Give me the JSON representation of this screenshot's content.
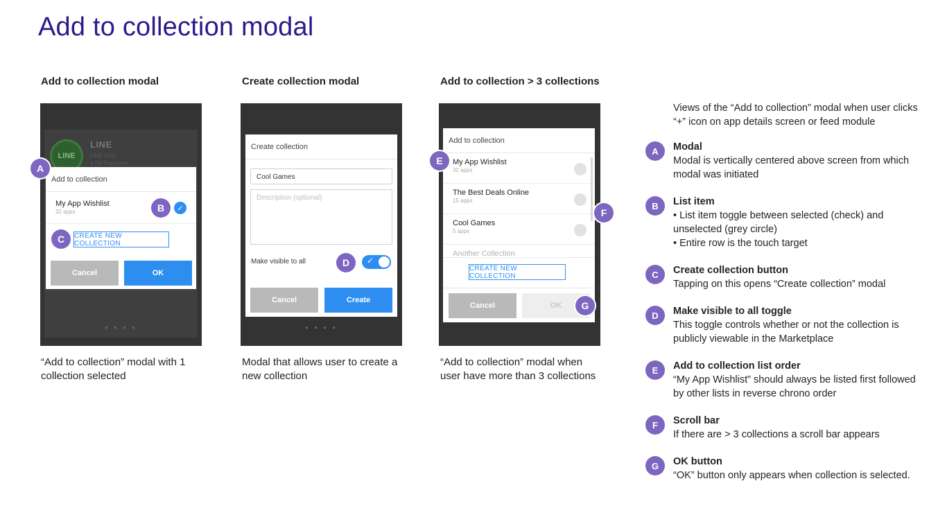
{
  "page_title": "Add to collection modal",
  "columns": [
    {
      "heading": "Add to collection modal",
      "caption_lines": [
        "“Add to collection” modal with 1",
        "collection selected"
      ]
    },
    {
      "heading": "Create collection modal",
      "caption_lines": [
        "Modal that allows user to create a",
        "new collection"
      ]
    },
    {
      "heading": "Add to collection > 3 collections",
      "caption_lines": [
        "“Add to collection” modal when",
        "user have more than 3 collections"
      ]
    }
  ],
  "screen1": {
    "bg_logo": "LINE",
    "bg_app_name": "LINE",
    "bg_app_sub": [
      "LINE Corp.",
      "4.5M Everyone"
    ],
    "modal_title": "Add to collection",
    "item": {
      "name": "My App Wishlist",
      "count": "32 apps",
      "selected": true
    },
    "create_label": "CREATE NEW COLLECTION",
    "cancel_label": "Cancel",
    "ok_label": "OK"
  },
  "screen2": {
    "modal_title": "Create collection",
    "name_value": "Cool Games",
    "description_placeholder": "Description (optional)",
    "visible_label": "Make visible to all",
    "visible_on": true,
    "cancel_label": "Cancel",
    "create_label": "Create"
  },
  "screen3": {
    "modal_title": "Add to collection",
    "items": [
      {
        "name": "My App Wishlist",
        "count": "32 apps"
      },
      {
        "name": "The Best Deals Online",
        "count": "15 apps"
      },
      {
        "name": "Cool Games",
        "count": "5 apps"
      },
      {
        "name": "Another Collection",
        "count": ""
      }
    ],
    "create_label": "CREATE NEW COLLECTION",
    "cancel_label": "Cancel",
    "ok_label": "OK"
  },
  "markers": [
    "A",
    "B",
    "C",
    "D",
    "E",
    "F",
    "G"
  ],
  "notes_intro": "Views of the “Add to collection” modal when user clicks “+” icon on app details screen or feed module",
  "notes": [
    {
      "letter": "A",
      "title": "Modal",
      "body": [
        "Modal is vertically centered above screen from which modal was initiated"
      ]
    },
    {
      "letter": "B",
      "title": "List item",
      "body": [
        "• List item toggle between selected (check) and unselected (grey circle)",
        "• Entire row is the touch target"
      ]
    },
    {
      "letter": "C",
      "title": "Create collection button",
      "body": [
        "Tapping on this opens “Create collection” modal"
      ]
    },
    {
      "letter": "D",
      "title": "Make visible to all toggle",
      "body": [
        "This toggle controls whether or not the collection is publicly viewable in the Marketplace"
      ]
    },
    {
      "letter": "E",
      "title": "Add to collection list order",
      "body": [
        "“My App Wishlist” should always be listed first followed by other lists in reverse chrono order"
      ]
    },
    {
      "letter": "F",
      "title": "Scroll bar",
      "body": [
        "If there are > 3 collections a scroll bar appears"
      ]
    },
    {
      "letter": "G",
      "title": "OK button",
      "body": [
        "“OK” button only appears when collection is selected."
      ]
    }
  ],
  "colors": {
    "title": "#2a1a8c",
    "accent": "#2d8ef0",
    "marker": "#7d66c0",
    "screen_dim": "#333333"
  }
}
